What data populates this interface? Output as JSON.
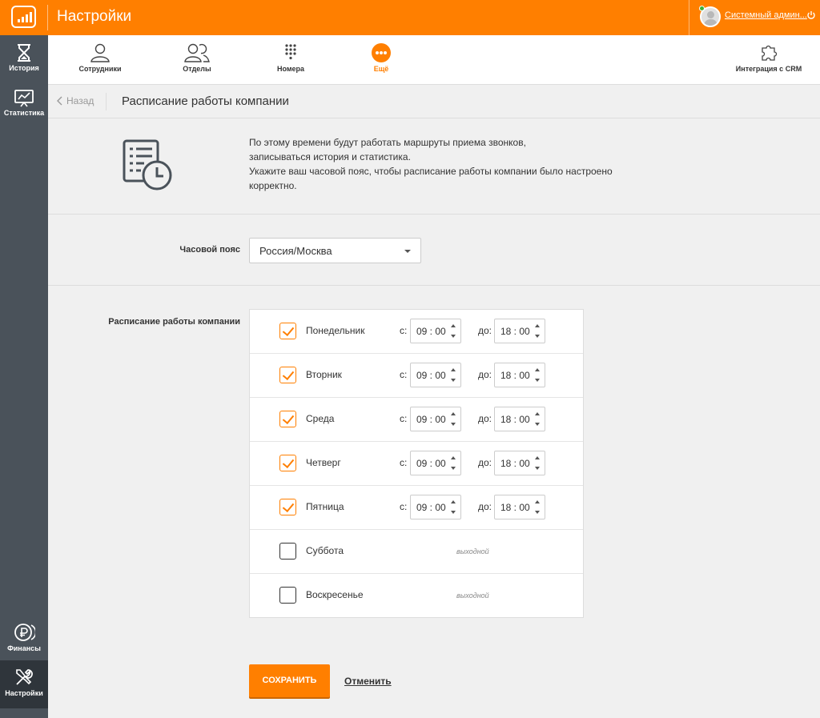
{
  "header": {
    "title": "Настройки",
    "user_name": "Системный админ...",
    "accent_color": "#ff7f00"
  },
  "sidebar": {
    "items": [
      {
        "label": "История",
        "icon": "hourglass-icon"
      },
      {
        "label": "Статистика",
        "icon": "presentation-chart-icon"
      },
      {
        "label": "Финансы",
        "icon": "ruble-coins-icon"
      },
      {
        "label": "Настройки",
        "icon": "wrench-screwdriver-icon",
        "active": true
      }
    ]
  },
  "nav": {
    "tabs": [
      {
        "label": "Сотрудники",
        "icon": "user-icon"
      },
      {
        "label": "Отделы",
        "icon": "users-icon"
      },
      {
        "label": "Номера",
        "icon": "keypad-icon"
      },
      {
        "label": "Ещё",
        "icon": "more-icon",
        "active": true
      },
      {
        "label": "Интеграция с CRM",
        "icon": "puzzle-icon"
      }
    ]
  },
  "breadcrumb": {
    "back_label": "Назад",
    "title": "Расписание работы компании"
  },
  "intro": {
    "lines": [
      "По этому времени будут работать маршруты приема звонков,",
      "записываться история и статистика.",
      "Укажите ваш часовой пояс, чтобы расписание работы компании было настроено",
      "корректно."
    ]
  },
  "timezone": {
    "label": "Часовой пояс",
    "value": "Россия/Москва"
  },
  "schedule": {
    "label": "Расписание работы компании",
    "from_label": "с:",
    "to_label": "до:",
    "day_off_label": "выходной",
    "days": [
      {
        "name": "Понедельник",
        "enabled": true,
        "from": "09 : 00",
        "to": "18 : 00"
      },
      {
        "name": "Вторник",
        "enabled": true,
        "from": "09 : 00",
        "to": "18 : 00"
      },
      {
        "name": "Среда",
        "enabled": true,
        "from": "09 : 00",
        "to": "18 : 00"
      },
      {
        "name": "Четверг",
        "enabled": true,
        "from": "09 : 00",
        "to": "18 : 00"
      },
      {
        "name": "Пятница",
        "enabled": true,
        "from": "09 : 00",
        "to": "18 : 00"
      },
      {
        "name": "Суббота",
        "enabled": false
      },
      {
        "name": "Воскресенье",
        "enabled": false
      }
    ]
  },
  "actions": {
    "save_label": "СОХРАНИТЬ",
    "cancel_label": "Отменить"
  }
}
